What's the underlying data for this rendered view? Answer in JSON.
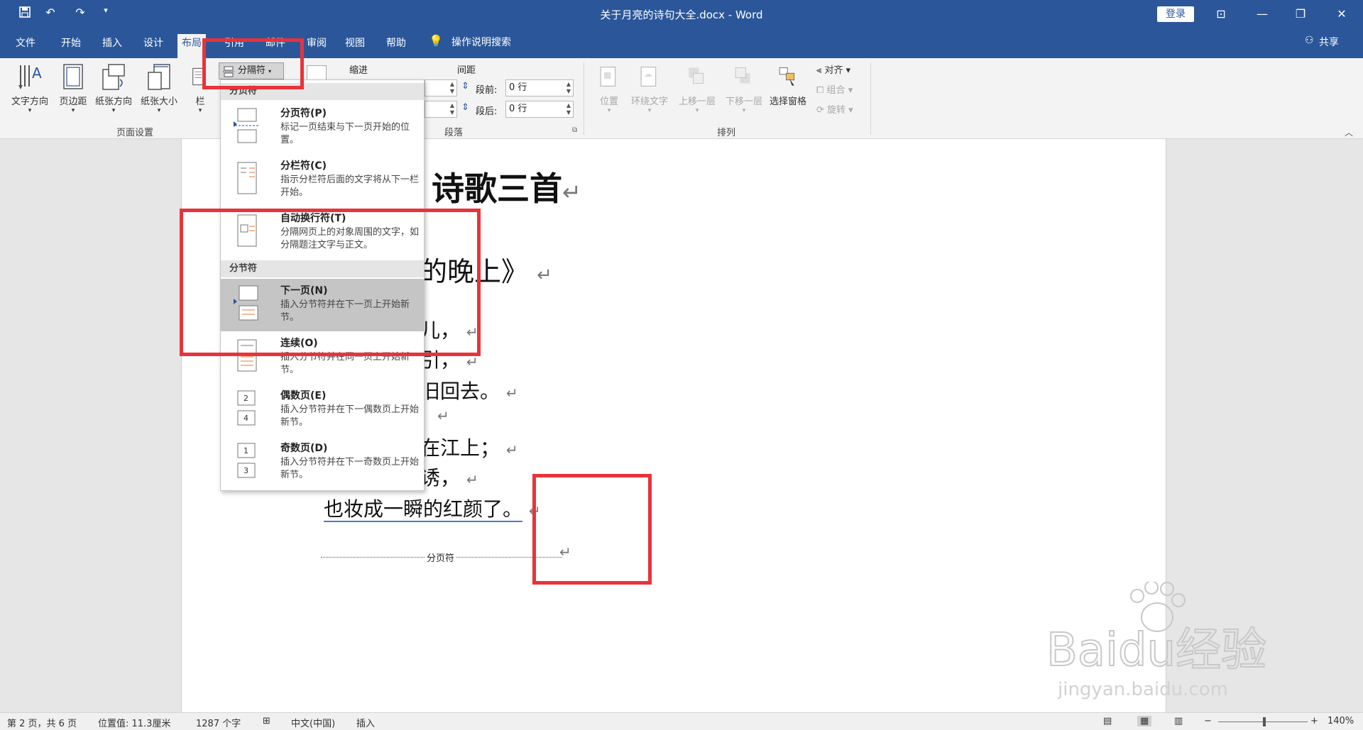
{
  "window": {
    "title": "关于月亮的诗句大全.docx - Word",
    "login_label": "登录",
    "share_label": "共享"
  },
  "tabs": [
    "文件",
    "开始",
    "插入",
    "设计",
    "布局",
    "引用",
    "邮件",
    "审阅",
    "视图",
    "帮助"
  ],
  "search_label": "操作说明搜索",
  "ribbon": {
    "page_setup": {
      "label": "页面设置",
      "buttons": [
        "文字方向",
        "页边距",
        "纸张方向",
        "纸张大小",
        "栏"
      ]
    },
    "breaks_button": "分隔符",
    "indent_label": "缩进",
    "spacing_label": "间距",
    "spacing_before_label": "段前:",
    "spacing_before_value": "0 行",
    "spacing_after_label": "段后:",
    "spacing_after_value": "0 行",
    "paragraph_label": "段落",
    "arrange": {
      "label": "排列",
      "buttons": [
        "位置",
        "环绕文字",
        "上移一层",
        "下移一层",
        "选择窗格"
      ],
      "align": "对齐",
      "group": "组合",
      "rotate": "旋转"
    }
  },
  "dropdown": {
    "section1_header": "分页符",
    "section2_header": "分节符",
    "items": [
      {
        "title": "分页符(P)",
        "desc": "标记一页结束与下一页开始的位置。"
      },
      {
        "title": "分栏符(C)",
        "desc": "指示分栏符后面的文字将从下一栏开始。"
      },
      {
        "title": "自动换行符(T)",
        "desc": "分隔网页上的对象周围的文字，如分隔题注文字与正文。"
      },
      {
        "title": "下一页(N)",
        "desc": "插入分节符并在下一页上开始新节。"
      },
      {
        "title": "连续(O)",
        "desc": "插入分节符并在同一页上开始新节。"
      },
      {
        "title": "偶数页(E)",
        "desc": "插入分节符并在下一偶数页上开始新节。"
      },
      {
        "title": "奇数页(D)",
        "desc": "插入分节符并在下一奇数页上开始新节。"
      }
    ]
  },
  "document": {
    "heading": "诗歌三首",
    "subtitle": "的晚上》",
    "lines": [
      "儿，",
      "引，",
      "旧回去。",
      "在江上；",
      "诱，",
      "也妆成一瞬的红颜了。"
    ],
    "page_break_label": "分页符",
    "pilcrow": "↵"
  },
  "status": {
    "page": "第 2 页，共 6 页",
    "position": "位置值: 11.3厘米",
    "words": "1287 个字",
    "language": "中文(中国)",
    "mode": "插入",
    "zoom": "140%"
  },
  "watermark": {
    "brand": "Baidu经验",
    "url": "jingyan.baidu.com"
  }
}
